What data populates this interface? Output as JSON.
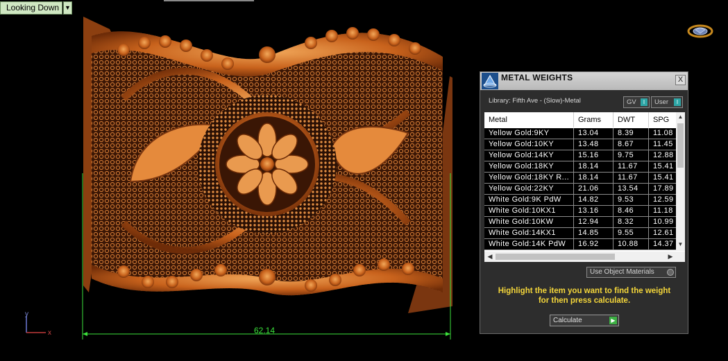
{
  "viewport": {
    "view_label": "Looking Down",
    "dimension": "62.14",
    "axis": {
      "y": "y",
      "x": "x"
    }
  },
  "panel": {
    "title": "METAL WEIGHTS",
    "library": "Library: Fifth Ave - (Slow)-Metal",
    "toggles": [
      {
        "label": "GV",
        "state": "I"
      },
      {
        "label": "User",
        "state": "I"
      }
    ],
    "table": {
      "columns": [
        "Metal",
        "Grams",
        "DWT",
        "SPG"
      ],
      "rows": [
        [
          "Yellow Gold:9KY",
          "13.04",
          "8.39",
          "11.08"
        ],
        [
          "Yellow Gold:10KY",
          "13.48",
          "8.67",
          "11.45"
        ],
        [
          "Yellow Gold:14KY",
          "15.16",
          "9.75",
          "12.88"
        ],
        [
          "Yellow Gold:18KY",
          "18.14",
          "11.67",
          "15.41"
        ],
        [
          "Yellow Gold:18KY R...",
          "18.14",
          "11.67",
          "15.41"
        ],
        [
          "Yellow Gold:22KY",
          "21.06",
          "13.54",
          "17.89"
        ],
        [
          "White Gold:9K PdW",
          "14.82",
          "9.53",
          "12.59"
        ],
        [
          "White Gold:10KX1",
          "13.16",
          "8.46",
          "11.18"
        ],
        [
          "White Gold:10KW",
          "12.94",
          "8.32",
          "10.99"
        ],
        [
          "White Gold:14KX1",
          "14.85",
          "9.55",
          "12.61"
        ],
        [
          "White Gold:14K PdW",
          "16.92",
          "10.88",
          "14.37"
        ]
      ]
    },
    "use_object_materials": "Use Object Materials",
    "hint_line1": "Highlight the item you want to find the weight",
    "hint_line2": "for then press calculate.",
    "calculate_label": "Calculate",
    "close_symbol": "X"
  },
  "colors": {
    "bracelet": "#c8621c",
    "dimension": "#3be23b",
    "hint": "#f4d63a"
  }
}
